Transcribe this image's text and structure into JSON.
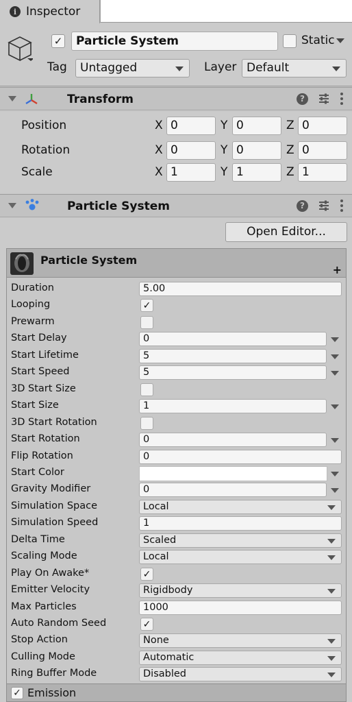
{
  "tab": {
    "title": "Inspector",
    "icon": "info-icon"
  },
  "gameobject": {
    "active": true,
    "name": "Particle System",
    "static_label": "Static",
    "static": false,
    "tag_label": "Tag",
    "tag_value": "Untagged",
    "layer_label": "Layer",
    "layer_value": "Default"
  },
  "transform": {
    "title": "Transform",
    "rows": [
      {
        "label": "Position",
        "x": "0",
        "y": "0",
        "z": "0"
      },
      {
        "label": "Rotation",
        "x": "0",
        "y": "0",
        "z": "0"
      },
      {
        "label": "Scale",
        "x": "1",
        "y": "1",
        "z": "1"
      }
    ],
    "axes": {
      "x": "X",
      "y": "Y",
      "z": "Z"
    }
  },
  "particle_component": {
    "title": "Particle System",
    "open_editor": "Open Editor...",
    "module_title": "Particle System",
    "module_add": "+"
  },
  "properties": [
    {
      "label": "Duration",
      "type": "field",
      "value": "5.00"
    },
    {
      "label": "Looping",
      "type": "checkbox",
      "value": "✓"
    },
    {
      "label": "Prewarm",
      "type": "checkbox",
      "value": ""
    },
    {
      "label": "Start Delay",
      "type": "curve",
      "value": "0"
    },
    {
      "label": "Start Lifetime",
      "type": "curve",
      "value": "5"
    },
    {
      "label": "Start Speed",
      "type": "curve",
      "value": "5"
    },
    {
      "label": "3D Start Size",
      "type": "checkbox",
      "value": ""
    },
    {
      "label": "Start Size",
      "type": "curve",
      "value": "1"
    },
    {
      "label": "3D Start Rotation",
      "type": "checkbox",
      "value": ""
    },
    {
      "label": "Start Rotation",
      "type": "curve",
      "value": "0"
    },
    {
      "label": "Flip Rotation",
      "type": "field",
      "value": "0"
    },
    {
      "label": "Start Color",
      "type": "color",
      "value": ""
    },
    {
      "label": "Gravity Modifier",
      "type": "curve",
      "value": "0"
    },
    {
      "label": "Simulation Space",
      "type": "dropdown",
      "value": "Local"
    },
    {
      "label": "Simulation Speed",
      "type": "field",
      "value": "1"
    },
    {
      "label": "Delta Time",
      "type": "dropdown",
      "value": "Scaled"
    },
    {
      "label": "Scaling Mode",
      "type": "dropdown",
      "value": "Local"
    },
    {
      "label": "Play On Awake*",
      "type": "checkbox",
      "value": "✓"
    },
    {
      "label": "Emitter Velocity",
      "type": "dropdown",
      "value": "Rigidbody"
    },
    {
      "label": "Max Particles",
      "type": "field",
      "value": "1000"
    },
    {
      "label": "Auto Random Seed",
      "type": "checkbox",
      "value": "✓"
    },
    {
      "label": "Stop Action",
      "type": "dropdown",
      "value": "None"
    },
    {
      "label": "Culling Mode",
      "type": "dropdown",
      "value": "Automatic"
    },
    {
      "label": "Ring Buffer Mode",
      "type": "dropdown",
      "value": "Disabled"
    }
  ],
  "emission": {
    "label": "Emission",
    "enabled": "✓"
  },
  "colors": {
    "start_color": "#ffffff",
    "transform_icon_red": "#d0402f",
    "transform_icon_green": "#3f9f3f",
    "transform_icon_blue": "#3a6fd8",
    "particle_icon_blue": "#3b7fe0"
  }
}
